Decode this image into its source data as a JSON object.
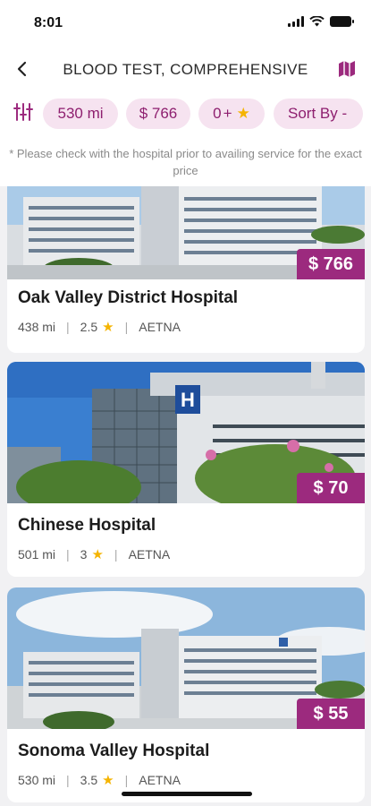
{
  "status_bar": {
    "time": "8:01"
  },
  "header": {
    "title": "BLOOD TEST, COMPREHENSIVE"
  },
  "filters": {
    "distance": "530 mi",
    "price": "$ 766",
    "rating_value": "0",
    "rating_plus": "+",
    "sort_label": "Sort By -"
  },
  "notice": "* Please check with the hospital prior to availing service for the exact price",
  "hospitals": [
    {
      "name": "Oak Valley District Hospital",
      "price": "$ 766",
      "distance": "438 mi",
      "rating": "2.5",
      "insurance": "AETNA"
    },
    {
      "name": "Chinese Hospital",
      "price": "$ 70",
      "distance": "501 mi",
      "rating": "3",
      "insurance": "AETNA"
    },
    {
      "name": "Sonoma Valley Hospital",
      "price": "$ 55",
      "distance": "530 mi",
      "rating": "3.5",
      "insurance": "AETNA"
    }
  ],
  "colors": {
    "accent": "#9c2a7e",
    "chip_bg": "#f6e3f0",
    "chip_text": "#8e1f6f",
    "star": "#f5b400"
  },
  "icons": [
    "back-arrow-icon",
    "map-icon",
    "filter-sliders-icon",
    "star-icon",
    "wifi-icon",
    "battery-icon",
    "signal-icon",
    "hospital-h-icon"
  ]
}
